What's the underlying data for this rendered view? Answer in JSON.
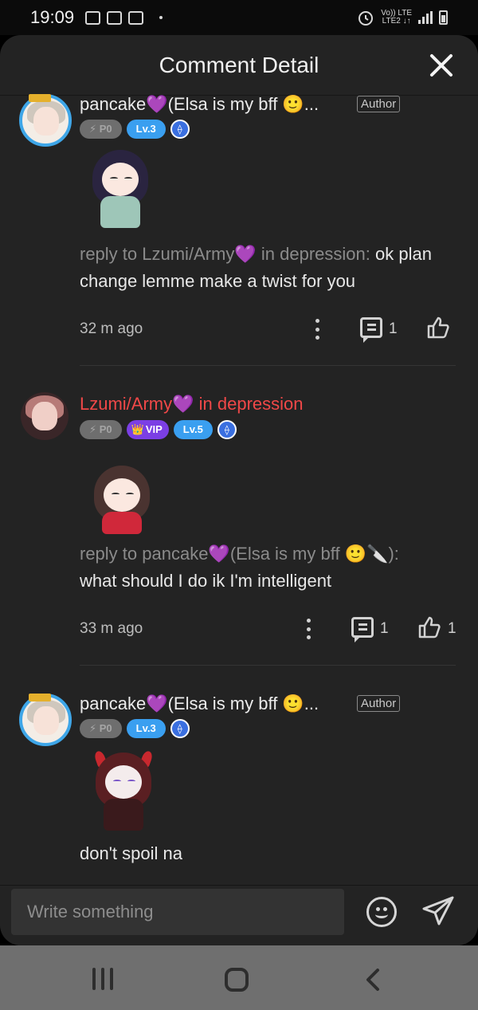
{
  "status_bar": {
    "time": "19:09",
    "network_line1": "Vo)) LTE",
    "network_line2": "LTE2 ↓↑"
  },
  "header": {
    "title": "Comment Detail"
  },
  "comments": [
    {
      "username": "pancake💜(Elsa is my bff 🙂...",
      "author_tag": "Author",
      "badges": {
        "po": "⚡ P0",
        "level": "Lv.3",
        "eth": "⟠"
      },
      "reply_prefix": "reply to Lzumi/Army💜 in depression: ",
      "text": "ok plan change lemme make a twist for you",
      "time": "32 m ago",
      "reply_count": "1",
      "like_count": ""
    },
    {
      "username": "Lzumi/Army💜 in depression",
      "badges": {
        "po": "⚡ P0",
        "vip": "VIP",
        "vip_icon": "👑",
        "level": "Lv.5",
        "eth": "⟠"
      },
      "reply_prefix": "reply to pancake💜(Elsa is my bff 🙂🔪):",
      "text": "what should I do ik I'm intelligent",
      "time": "33 m ago",
      "reply_count": "1",
      "like_count": "1"
    },
    {
      "username": "pancake💜(Elsa is my bff 🙂...",
      "author_tag": "Author",
      "badges": {
        "po": "⚡ P0",
        "level": "Lv.3",
        "eth": "⟠"
      },
      "text": "don't spoil na"
    }
  ],
  "input": {
    "placeholder": "Write something"
  },
  "colors": {
    "sheet_bg": "#232323",
    "accent_blue": "#3a9ff0",
    "username_red": "#f04848",
    "vip_purple": "#7b3fe4"
  }
}
